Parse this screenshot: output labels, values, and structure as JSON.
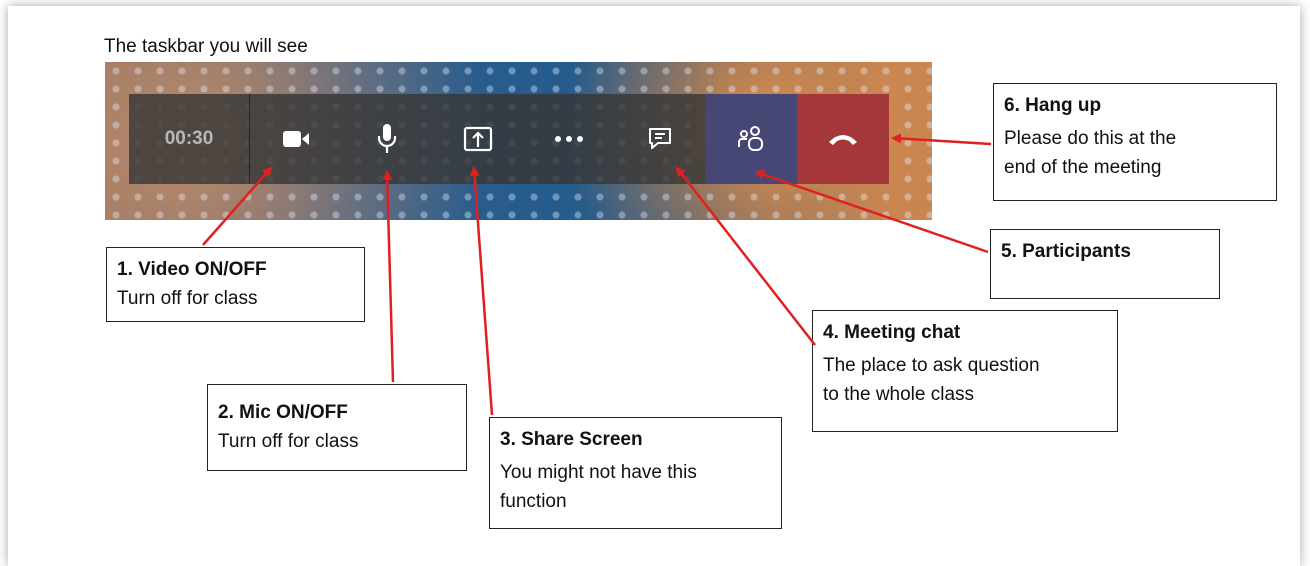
{
  "caption": "The taskbar you will see",
  "taskbar": {
    "timer": "00:30",
    "buttons": [
      {
        "name": "video",
        "icon": "video-camera-icon"
      },
      {
        "name": "mic",
        "icon": "microphone-icon"
      },
      {
        "name": "share",
        "icon": "share-screen-icon"
      },
      {
        "name": "more",
        "icon": "more-dots-icon"
      },
      {
        "name": "chat",
        "icon": "chat-icon"
      },
      {
        "name": "participants",
        "icon": "participants-icon"
      },
      {
        "name": "hangup",
        "icon": "phone-hangup-icon"
      }
    ]
  },
  "callouts": {
    "video": {
      "title": "1. Video ON/OFF",
      "desc": "Turn off for class"
    },
    "mic": {
      "title": "2. Mic ON/OFF",
      "desc": "Turn off for class"
    },
    "share": {
      "title": "3. Share Screen",
      "desc1": "You might not have this",
      "desc2": "function"
    },
    "chat": {
      "title": "4. Meeting chat",
      "desc1": "The place to ask question",
      "desc2": "to the whole class"
    },
    "participants": {
      "title": "5. Participants"
    },
    "hangup": {
      "title": "6. Hang up",
      "desc1": "Please do this at the",
      "desc2": "end of the meeting"
    }
  },
  "colors": {
    "participants_bg": "#464775",
    "hangup_bg": "#a4373a",
    "arrow": "#e02020"
  }
}
